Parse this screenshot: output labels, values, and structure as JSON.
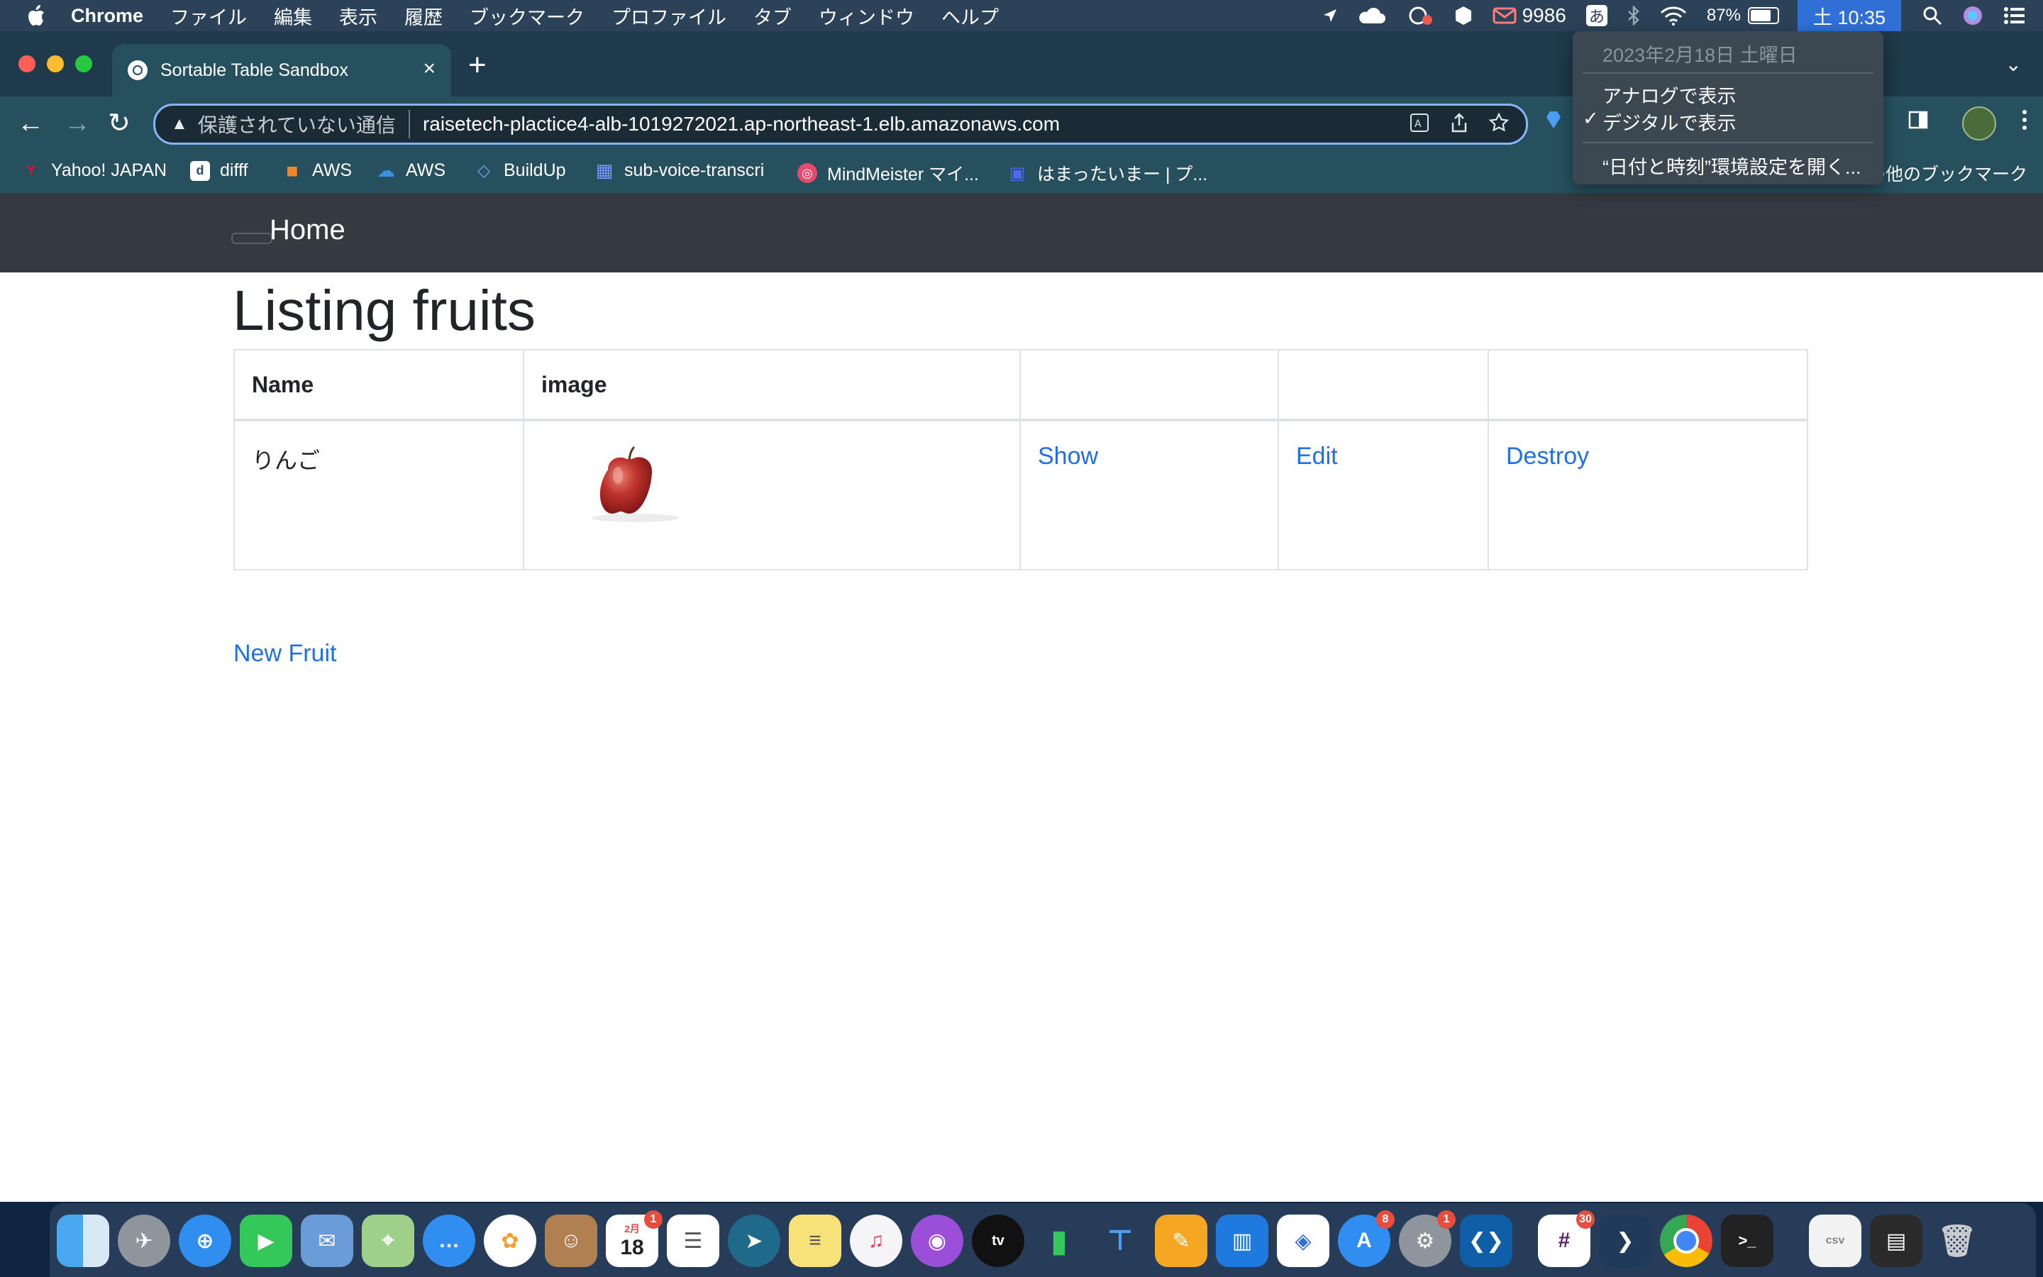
{
  "menubar": {
    "app_name": "Chrome",
    "menus": [
      "ファイル",
      "編集",
      "表示",
      "履歴",
      "ブックマーク",
      "プロファイル",
      "タブ",
      "ウィンドウ",
      "ヘルプ"
    ],
    "mail_count": "9986",
    "ime": "あ",
    "battery": "87%",
    "battery_level": 0.87,
    "clock": "土 10:35"
  },
  "clock_menu": {
    "date": "2023年2月18日 土曜日",
    "analog": "アナログで表示",
    "digital": "デジタルで表示",
    "check": "✓",
    "open_prefs": "“日付と時刻”環境設定を開く..."
  },
  "tab": {
    "title": "Sortable Table Sandbox",
    "close": "×",
    "new_tab": "+",
    "tab_menu": "⌄"
  },
  "toolbar": {
    "back": "←",
    "forward": "→",
    "reload": "↻",
    "insecure_label": "保護されていない通信",
    "url": "raisetech-plactice4-alb-1019272021.ap-northeast-1.elb.amazonaws.com"
  },
  "bookmarks": {
    "items": [
      {
        "label": "Yahoo! JAPAN",
        "icon": "Y",
        "color": "#ff0033"
      },
      {
        "label": "difff",
        "icon": "d",
        "color": "#ffffff"
      },
      {
        "label": "AWS",
        "icon": "■",
        "color": "#f0882a"
      },
      {
        "label": "AWS",
        "icon": "☁",
        "color": "#2f6fd6"
      },
      {
        "label": "BuildUp",
        "icon": "◇",
        "color": "#4a7bd8"
      },
      {
        "label": "sub-voice-transcri",
        "icon": "▦",
        "color": "#4a6ff0"
      },
      {
        "label": "MindMeister マイ...",
        "icon": "◎",
        "color": "#e84a6f"
      },
      {
        "label": "はまったいまー | プ...",
        "icon": "▣",
        "color": "#3a5ad8"
      }
    ],
    "other": "の他のブックマーク"
  },
  "app": {
    "nav_home": "Home",
    "title": "Listing fruits",
    "table": {
      "headers": [
        "Name",
        "image",
        "",
        "",
        ""
      ],
      "rows": [
        {
          "name": "りんご",
          "show": "Show",
          "edit": "Edit",
          "destroy": "Destroy"
        }
      ]
    },
    "new_fruit": "New Fruit"
  },
  "dock": {
    "calendar_month": "2月",
    "calendar_day": "18",
    "badges": {
      "calendar": "1",
      "appstore": "8",
      "settings": "1",
      "slack": "30"
    }
  },
  "colors": {
    "link": "#1f6feb",
    "navbar": "#343a40",
    "menubar": "#2b4258",
    "tabstrip": "#1f3a4a",
    "toolbar": "#27505f",
    "clock_highlight": "#2f6fd6"
  }
}
